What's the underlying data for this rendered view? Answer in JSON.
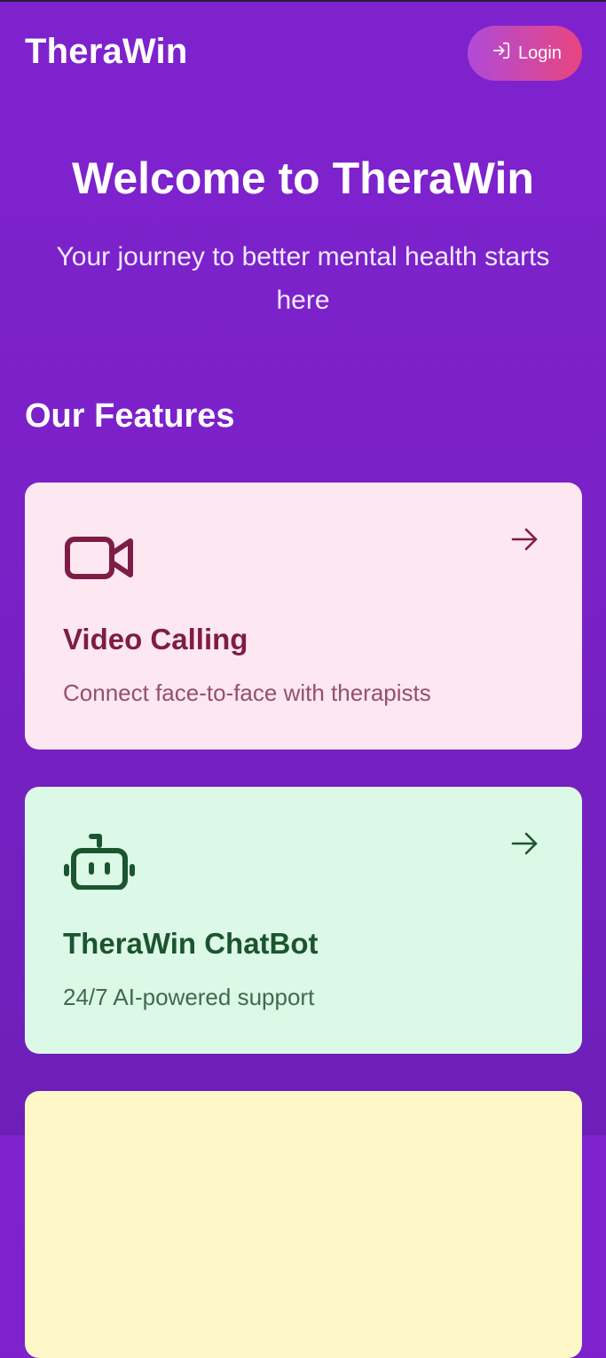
{
  "app": {
    "brand": "TheraWin"
  },
  "header": {
    "login_label": "Login"
  },
  "hero": {
    "title": "Welcome to TheraWin",
    "subtitle": "Your journey to better mental health starts here"
  },
  "features": {
    "heading": "Our Features",
    "items": [
      {
        "title": "Video Calling",
        "description": "Connect face-to-face with therapists",
        "icon": "video-camera-icon",
        "accent": "#7d1d45",
        "background": "#fde7f1"
      },
      {
        "title": "TheraWin ChatBot",
        "description": "24/7 AI-powered support",
        "icon": "robot-icon",
        "accent": "#1b5530",
        "background": "#dcf8e6"
      },
      {
        "title": "",
        "description": "",
        "icon": "",
        "accent": "",
        "background": "#fef8c8"
      }
    ]
  },
  "colors": {
    "background_top": "#7e22ce",
    "background_bottom": "#6d1fb8",
    "login_gradient_start": "#b04ad8",
    "login_gradient_end": "#e9457f"
  }
}
